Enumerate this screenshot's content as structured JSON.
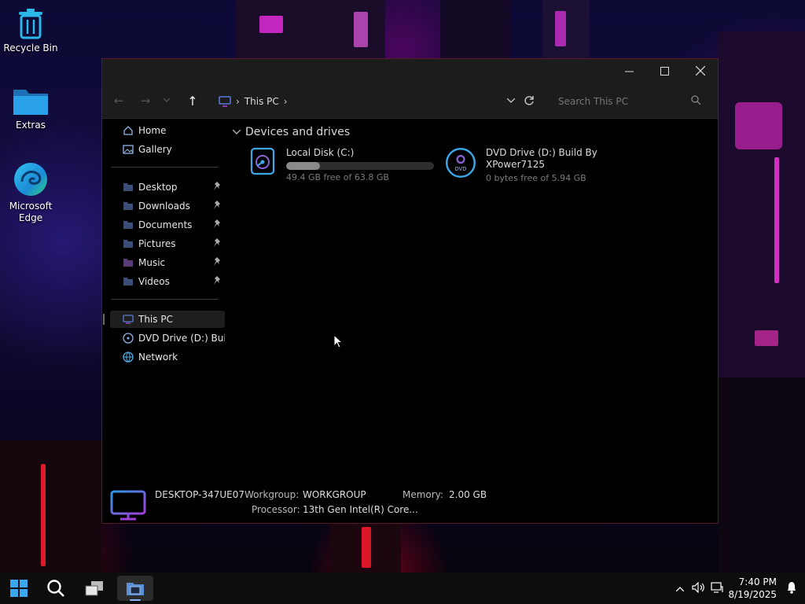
{
  "desktop": {
    "icons": [
      {
        "label": "Recycle Bin"
      },
      {
        "label": "Extras"
      },
      {
        "label": "Microsoft Edge"
      }
    ]
  },
  "window": {
    "nav": {
      "back": "←",
      "forward": "→",
      "up": "↑",
      "breadcrumb": [
        "This PC"
      ],
      "search_placeholder": "Search This PC"
    },
    "sidebar": {
      "top": [
        {
          "label": "Home",
          "icon": "home-icon"
        },
        {
          "label": "Gallery",
          "icon": "gallery-icon"
        }
      ],
      "pinned": [
        {
          "label": "Desktop",
          "icon": "desktop-folder-icon"
        },
        {
          "label": "Downloads",
          "icon": "downloads-folder-icon"
        },
        {
          "label": "Documents",
          "icon": "documents-folder-icon"
        },
        {
          "label": "Pictures",
          "icon": "pictures-folder-icon"
        },
        {
          "label": "Music",
          "icon": "music-folder-icon"
        },
        {
          "label": "Videos",
          "icon": "videos-folder-icon"
        }
      ],
      "bottom": [
        {
          "label": "This PC",
          "icon": "computer-icon",
          "selected": true
        },
        {
          "label": "DVD Drive (D:) Build",
          "icon": "dvd-icon"
        },
        {
          "label": "Network",
          "icon": "network-icon"
        }
      ]
    },
    "section": {
      "title": "Devices and drives"
    },
    "drives": [
      {
        "name": "Local Disk (C:)",
        "free": "49.4 GB free of 63.8 GB",
        "used_fraction": 0.23
      },
      {
        "name_line1": "DVD Drive (D:) Build By",
        "name_line2": "XPower7125",
        "free": "0 bytes free of 5.94 GB"
      }
    ],
    "details": {
      "computer_name": "DESKTOP-347UE07",
      "workgroup_label": "Workgroup:",
      "workgroup_value": "WORKGROUP",
      "memory_label": "Memory:",
      "memory_value": "2.00 GB",
      "processor_label": "Processor:",
      "processor_value": "13th Gen Intel(R) Core..."
    }
  },
  "taskbar": {
    "time": "7:40 PM",
    "date": "8/19/2025"
  },
  "colors": {
    "accent_blue": "#2aa1e8",
    "window_bg": "#000000",
    "chrome_bg": "#1c1c1c",
    "window_border": "#5a1a28"
  }
}
